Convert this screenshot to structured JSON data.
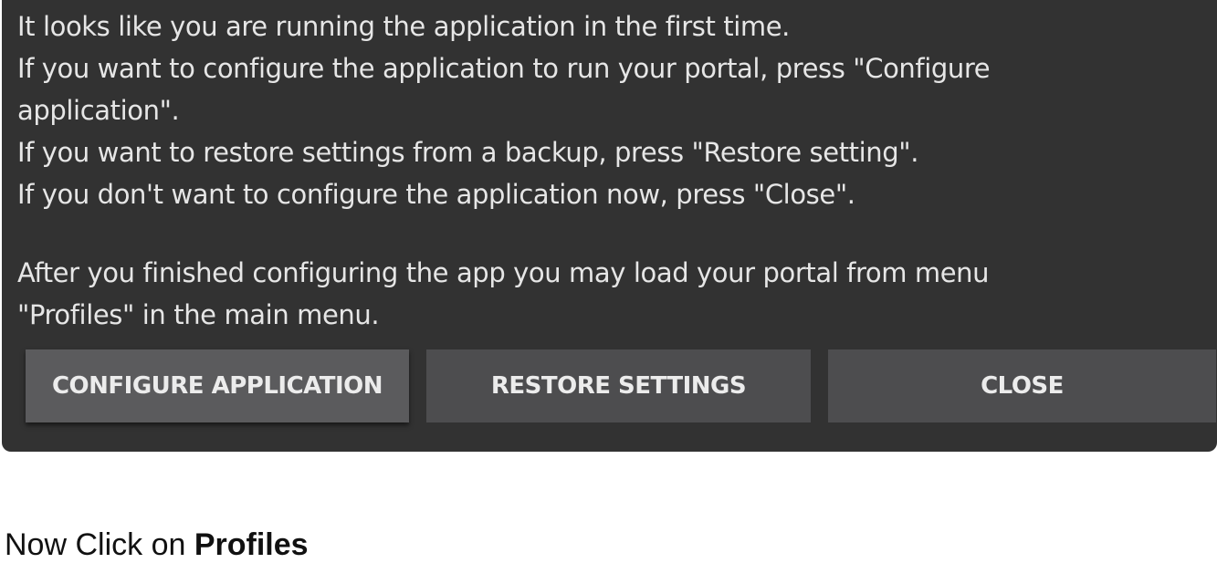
{
  "dialog": {
    "lines": [
      "It looks like you are running the application in the first time.",
      " If you want to configure the application to run your portal, press \"Configure",
      "application\".",
      " If you want to restore settings from a backup, press \"Restore setting\".",
      " If you don't want to configure the application now, press \"Close\"."
    ],
    "lines2": [
      " After you finished configuring the app you may load your portal from menu",
      "\"Profiles\" in the main menu."
    ],
    "buttons": {
      "configure": "CONFIGURE APPLICATION",
      "restore": "RESTORE SETTINGS",
      "close": "CLOSE"
    }
  },
  "caption": {
    "prefix": "Now Click on ",
    "bold": "Profiles"
  }
}
